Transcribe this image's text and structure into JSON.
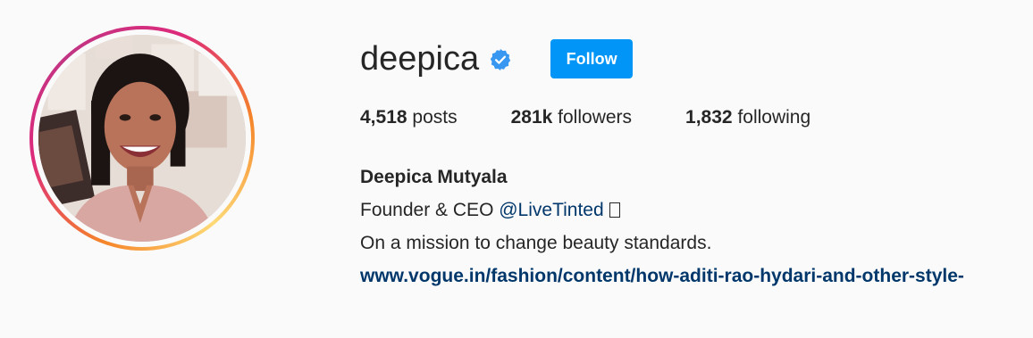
{
  "profile": {
    "username": "deepica",
    "verified": true,
    "follow_label": "Follow",
    "stats": {
      "posts_count": "4,518",
      "posts_label": "posts",
      "followers_count": "281k",
      "followers_label": "followers",
      "following_count": "1,832",
      "following_label": "following"
    },
    "bio": {
      "full_name": "Deepica Mutyala",
      "line1_prefix": "Founder & CEO ",
      "line1_mention": "@LiveTinted",
      "line2": "On a mission to change beauty standards.",
      "link": "www.vogue.in/fashion/content/how-aditi-rao-hydari-and-other-style-"
    }
  },
  "colors": {
    "follow_button": "#0095f6",
    "link": "#00376b",
    "verified_badge": "#3897f0",
    "background": "#fafafa"
  },
  "icons": {
    "verified": "verified-badge-icon",
    "emoji": "unrendered-emoji-glyph"
  }
}
